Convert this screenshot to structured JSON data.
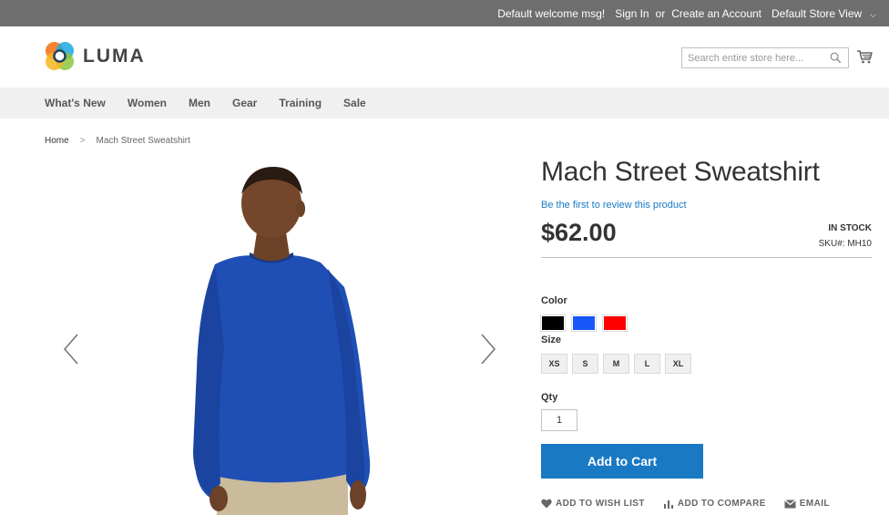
{
  "topbar": {
    "welcome": "Default welcome msg!",
    "sign_in": "Sign In",
    "or": "or",
    "create_account": "Create an Account",
    "store_switcher": "Default Store View"
  },
  "header": {
    "logo_text": "LUMA",
    "search_placeholder": "Search entire store here...",
    "icons": [
      "search-icon",
      "cart-icon"
    ]
  },
  "nav": {
    "items": [
      {
        "label": "What's New"
      },
      {
        "label": "Women"
      },
      {
        "label": "Men"
      },
      {
        "label": "Gear"
      },
      {
        "label": "Training"
      },
      {
        "label": "Sale"
      }
    ]
  },
  "breadcrumb": {
    "home": "Home",
    "separator": ">",
    "current": "Mach Street Sweatshirt"
  },
  "product": {
    "title": "Mach Street Sweatshirt",
    "review_link": "Be the first to review this product",
    "price": "$62.00",
    "stock": "IN STOCK",
    "sku": "SKU#:  MH10",
    "color_label": "Color",
    "colors": [
      {
        "name": "Black",
        "hex": "#000000"
      },
      {
        "name": "Blue",
        "hex": "#1857f7"
      },
      {
        "name": "Red",
        "hex": "#ff0000"
      }
    ],
    "size_label": "Size",
    "sizes": [
      "XS",
      "S",
      "M",
      "L",
      "XL"
    ],
    "qty_label": "Qty",
    "qty_value": "1",
    "add_to_cart": "Add to Cart",
    "add_to_wishlist": "ADD TO WISH LIST",
    "add_to_compare": "ADD TO COMPARE",
    "email": "EMAIL"
  },
  "colors": {
    "accent": "#1979c3",
    "topbar_bg": "#6e6e6e",
    "nav_bg": "#f0f0f0"
  }
}
